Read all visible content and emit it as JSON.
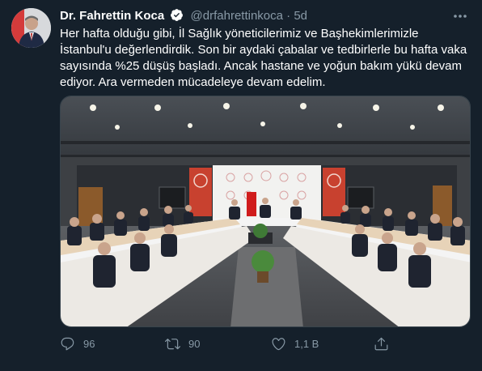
{
  "tweet": {
    "author_name": "Dr. Fahrettin Koca",
    "handle": "@drfahrettinkoca",
    "separator": "·",
    "time": "5d",
    "text_lines": [
      "Her hafta olduğu gibi, İl Sağlık yöneticilerimiz ve Başhekimlerimizle",
      "İstanbul'u değerlendirdik. Son bir aydaki çabalar ve tedbirlerle bu hafta vaka",
      "sayısında %25 düşüş başladı. Ancak hastane ve yoğun bakım yükü devam",
      "ediyor. Ara vermeden mücadeleye devam edelim."
    ]
  },
  "actions": {
    "reply_count": "96",
    "retweet_count": "90",
    "like_count": "1,1 B"
  },
  "icons": {
    "verified": "verified-badge-icon",
    "more": "more-options-icon",
    "reply": "reply-icon",
    "retweet": "retweet-icon",
    "like": "heart-icon",
    "share": "share-icon"
  },
  "colors": {
    "background": "#15202b",
    "secondary_text": "#8899a6",
    "verified_badge": "#ffffff",
    "banner_red": "#c8412f"
  }
}
